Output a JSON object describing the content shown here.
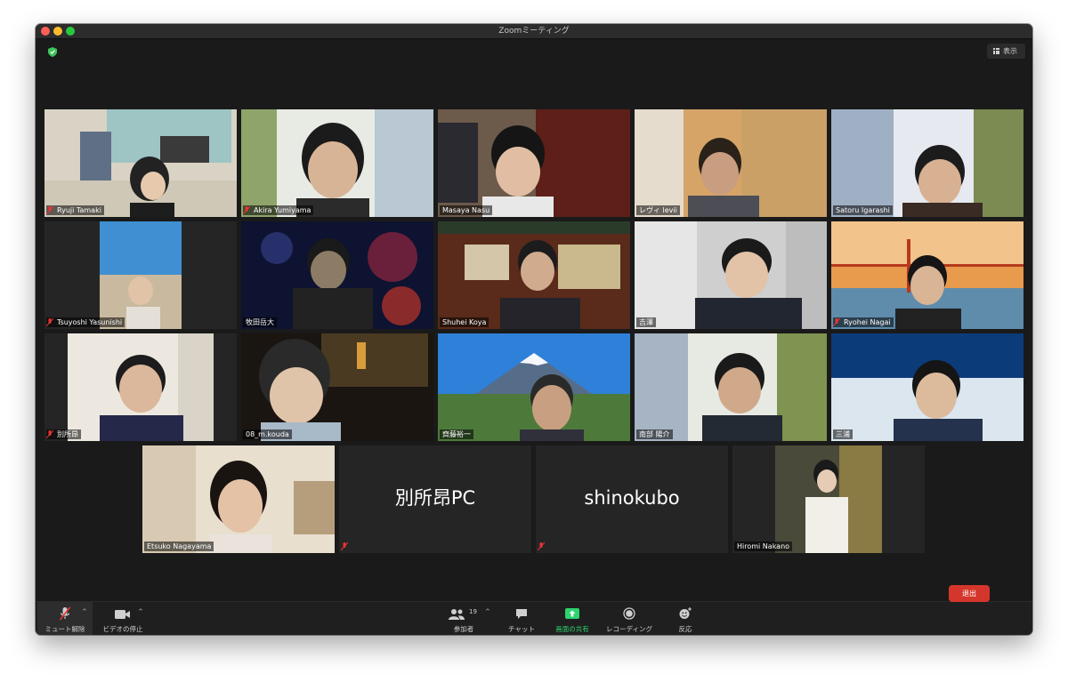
{
  "window": {
    "title": "Zoomミーティング"
  },
  "view_button": {
    "label": "表示"
  },
  "participants": [
    {
      "name": "Ryuji Tamaki",
      "muted": true
    },
    {
      "name": "Akira Yumiyama",
      "muted": true
    },
    {
      "name": "Masaya Nasu",
      "muted": false
    },
    {
      "name": "レヴィ levii",
      "muted": false,
      "active": true
    },
    {
      "name": "Satoru Igarashi",
      "muted": false
    },
    {
      "name": "Tsuyoshi Yasunishi",
      "muted": true
    },
    {
      "name": "牧田岳大",
      "muted": false
    },
    {
      "name": "Shuhei Koya",
      "muted": false
    },
    {
      "name": "吉澤",
      "muted": false
    },
    {
      "name": "Ryohei Nagai",
      "muted": true
    },
    {
      "name": "別所昂",
      "muted": true
    },
    {
      "name": "08_m.kouda",
      "muted": false
    },
    {
      "name": "齊藤裕一",
      "muted": false
    },
    {
      "name": "南部 陽介",
      "muted": false
    },
    {
      "name": "三浦",
      "muted": false
    },
    {
      "name": "Etsuko Nagayama",
      "muted": false
    },
    {
      "name": "別所昂PC",
      "muted": true
    },
    {
      "name": "shinokubo",
      "muted": true
    },
    {
      "name": "Hiromi Nakano",
      "muted": false
    }
  ],
  "toolbar": {
    "unmute": "ミュート解除",
    "stop_video": "ビデオの停止",
    "participants": "参加者",
    "participants_count": "19",
    "chat": "チャット",
    "share": "画面の共有",
    "record": "レコーディング",
    "reactions": "反応",
    "leave": "退出"
  },
  "colors": {
    "accent_active": "#d6e36a",
    "share_green": "#2dd36f",
    "leave_red": "#d5362c"
  }
}
